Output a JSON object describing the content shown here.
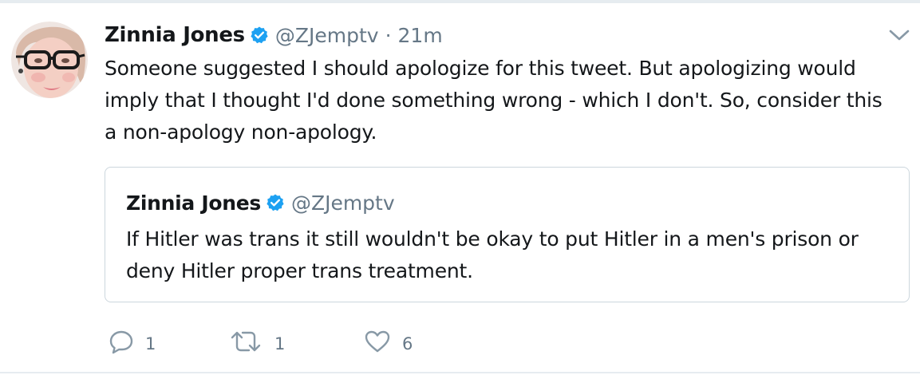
{
  "tweet": {
    "author_name": "Zinnia Jones",
    "handle": "@ZJemptv",
    "separator": "·",
    "time": "21m",
    "text": "Someone suggested I should apologize for this tweet. But apologizing would imply that I thought I'd done something wrong - which I don't. So, consider this a non-apology non-apology."
  },
  "quoted_tweet": {
    "author_name": "Zinnia Jones",
    "handle": "@ZJemptv",
    "text": "If Hitler was trans it still wouldn't be okay to put Hitler in a men's prison or deny Hitler proper trans treatment."
  },
  "actions": {
    "reply_count": "1",
    "retweet_count": "1",
    "like_count": "6"
  },
  "icons": {
    "verified": "verified-badge-icon",
    "caret": "chevron-down-icon",
    "reply": "reply-icon",
    "retweet": "retweet-icon",
    "like": "heart-icon"
  },
  "colors": {
    "verified_blue": "#1da1f2",
    "secondary_text": "#657786",
    "primary_text": "#14171a",
    "border": "#ccd6dd"
  }
}
